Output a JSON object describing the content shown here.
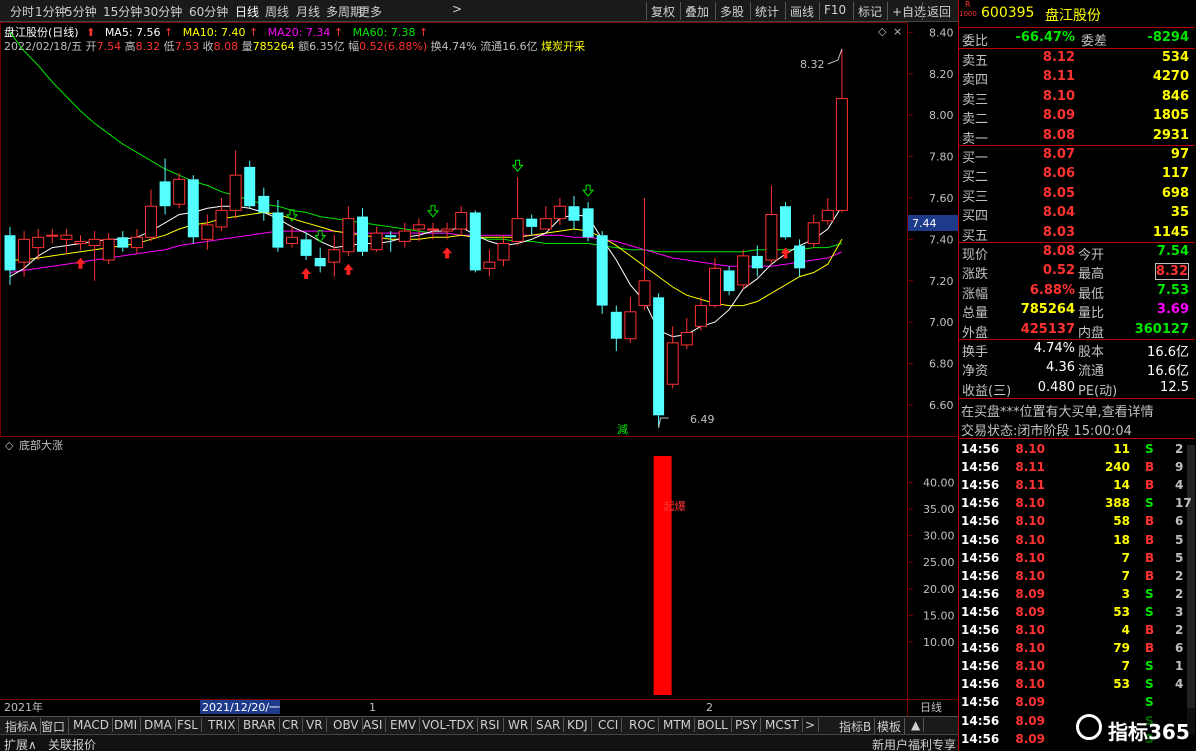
{
  "toolbar": {
    "periods": [
      "分时",
      "1分钟",
      "5分钟",
      "15分钟",
      "30分钟",
      "60分钟",
      "日线",
      "周线",
      "月线",
      "多周期",
      "更多"
    ],
    "active": "日线",
    "right_buttons": [
      "复权",
      "叠加",
      "多股",
      "统计",
      "画线",
      "F10",
      "标记",
      "+自选",
      "返回"
    ]
  },
  "chart_header": {
    "title": "盘江股份(日线)",
    "ma5": "MA5: 7.56",
    "ma10": "MA10: 7.40",
    "ma20": "MA20: 7.34",
    "ma60": "MA60: 7.38",
    "date": "2022/02/18/五",
    "open_label": "开",
    "open": "7.54",
    "high_label": "高",
    "high": "8.32",
    "low_label": "低",
    "low": "7.53",
    "close_label": "收",
    "close": "8.08",
    "vol_label": "量",
    "vol": "785264",
    "amount": "额6.35亿",
    "change_label": "幅",
    "change": "0.52(6.88%)",
    "turnover": "换4.74%",
    "float": "流通16.6亿",
    "concept": "煤炭开采"
  },
  "price_axis": [
    "8.40",
    "8.20",
    "8.00",
    "7.80",
    "7.60",
    "7.40",
    "7.20",
    "7.00",
    "6.80",
    "6.60"
  ],
  "price_tag": "7.44",
  "annotations": {
    "max_label": "8.32",
    "min_label": "6.49",
    "reduce_marker": "減"
  },
  "indicator": {
    "title": "底部大涨",
    "axis": [
      "40.00",
      "35.00",
      "30.00",
      "25.00",
      "20.00",
      "15.00",
      "10.00"
    ],
    "bar_label": "起爆"
  },
  "time_axis": {
    "year": "2021年",
    "cursor_date": "2021/12/20/一",
    "m1": "1",
    "m2": "2",
    "period": "日线"
  },
  "chart_data": {
    "type": "candlestick",
    "ylim": [
      6.45,
      8.45
    ],
    "candles": [
      [
        7.42,
        7.25,
        7.46,
        7.18
      ],
      [
        7.29,
        7.4,
        7.44,
        7.22
      ],
      [
        7.36,
        7.41,
        7.45,
        7.3
      ],
      [
        7.42,
        7.42,
        7.45,
        7.38
      ],
      [
        7.4,
        7.42,
        7.45,
        7.33
      ],
      [
        7.38,
        7.39,
        7.42,
        7.35
      ],
      [
        7.37,
        7.4,
        7.44,
        7.2
      ],
      [
        7.3,
        7.4,
        7.43,
        7.28
      ],
      [
        7.41,
        7.36,
        7.44,
        7.34
      ],
      [
        7.36,
        7.41,
        7.45,
        7.33
      ],
      [
        7.41,
        7.56,
        7.64,
        7.39
      ],
      [
        7.68,
        7.56,
        7.79,
        7.52
      ],
      [
        7.57,
        7.69,
        7.72,
        7.55
      ],
      [
        7.69,
        7.41,
        7.71,
        7.38
      ],
      [
        7.4,
        7.47,
        7.52,
        7.35
      ],
      [
        7.46,
        7.54,
        7.6,
        7.44
      ],
      [
        7.54,
        7.71,
        7.83,
        7.5
      ],
      [
        7.75,
        7.56,
        7.78,
        7.55
      ],
      [
        7.61,
        7.53,
        7.65,
        7.49
      ],
      [
        7.53,
        7.36,
        7.59,
        7.34
      ],
      [
        7.38,
        7.41,
        7.46,
        7.36
      ],
      [
        7.4,
        7.32,
        7.43,
        7.3
      ],
      [
        7.31,
        7.27,
        7.36,
        7.24
      ],
      [
        7.29,
        7.35,
        7.42,
        7.22
      ],
      [
        7.34,
        7.5,
        7.56,
        7.32
      ],
      [
        7.51,
        7.34,
        7.55,
        7.32
      ],
      [
        7.35,
        7.43,
        7.46,
        7.34
      ],
      [
        7.42,
        7.41,
        7.44,
        7.34
      ],
      [
        7.39,
        7.44,
        7.48,
        7.36
      ],
      [
        7.45,
        7.47,
        7.5,
        7.39
      ],
      [
        7.45,
        7.45,
        7.48,
        7.4
      ],
      [
        7.44,
        7.45,
        7.48,
        7.4
      ],
      [
        7.45,
        7.53,
        7.56,
        7.42
      ],
      [
        7.53,
        7.25,
        7.54,
        7.24
      ],
      [
        7.26,
        7.29,
        7.35,
        7.22
      ],
      [
        7.3,
        7.38,
        7.42,
        7.27
      ],
      [
        7.39,
        7.5,
        7.7,
        7.37
      ],
      [
        7.5,
        7.46,
        7.52,
        7.42
      ],
      [
        7.45,
        7.5,
        7.56,
        7.45
      ],
      [
        7.5,
        7.56,
        7.6,
        7.47
      ],
      [
        7.56,
        7.49,
        7.61,
        7.45
      ],
      [
        7.55,
        7.41,
        7.58,
        7.39
      ],
      [
        7.42,
        7.08,
        7.44,
        7.04
      ],
      [
        7.05,
        6.92,
        7.08,
        6.86
      ],
      [
        6.92,
        7.05,
        7.12,
        6.9
      ],
      [
        7.08,
        7.2,
        7.6,
        7.06
      ],
      [
        7.12,
        6.55,
        7.14,
        6.49
      ],
      [
        6.7,
        6.9,
        6.98,
        6.68
      ],
      [
        6.89,
        6.95,
        7.02,
        6.87
      ],
      [
        6.98,
        7.08,
        7.12,
        6.96
      ],
      [
        7.08,
        7.26,
        7.31,
        7.07
      ],
      [
        7.25,
        7.15,
        7.27,
        7.13
      ],
      [
        7.18,
        7.32,
        7.35,
        7.16
      ],
      [
        7.32,
        7.26,
        7.37,
        7.22
      ],
      [
        7.3,
        7.52,
        7.66,
        7.28
      ],
      [
        7.56,
        7.41,
        7.58,
        7.4
      ],
      [
        7.37,
        7.26,
        7.4,
        7.22
      ],
      [
        7.38,
        7.48,
        7.52,
        7.36
      ],
      [
        7.49,
        7.54,
        7.6,
        7.47
      ],
      [
        7.54,
        8.08,
        8.32,
        7.53
      ]
    ],
    "ma5": [
      7.22,
      7.26,
      7.32,
      7.36,
      7.37,
      7.38,
      7.39,
      7.4,
      7.4,
      7.41,
      7.44,
      7.48,
      7.52,
      7.53,
      7.55,
      7.56,
      7.56,
      7.55,
      7.53,
      7.5,
      7.46,
      7.43,
      7.39,
      7.36,
      7.37,
      7.38,
      7.38,
      7.39,
      7.41,
      7.42,
      7.44,
      7.44,
      7.46,
      7.42,
      7.39,
      7.37,
      7.38,
      7.4,
      7.43,
      7.5,
      7.52,
      7.51,
      7.4,
      7.3,
      7.18,
      7.1,
      6.96,
      6.93,
      6.94,
      6.98,
      7.0,
      7.06,
      7.16,
      7.21,
      7.28,
      7.33,
      7.37,
      7.4,
      7.45,
      7.56
    ],
    "ma10": [
      7.3,
      7.3,
      7.31,
      7.32,
      7.33,
      7.34,
      7.35,
      7.36,
      7.37,
      7.38,
      7.4,
      7.42,
      7.45,
      7.47,
      7.48,
      7.5,
      7.51,
      7.52,
      7.53,
      7.52,
      7.5,
      7.48,
      7.46,
      7.44,
      7.43,
      7.42,
      7.41,
      7.4,
      7.4,
      7.4,
      7.41,
      7.41,
      7.42,
      7.41,
      7.41,
      7.41,
      7.41,
      7.42,
      7.43,
      7.44,
      7.45,
      7.44,
      7.41,
      7.37,
      7.32,
      7.27,
      7.22,
      7.17,
      7.13,
      7.11,
      7.09,
      7.08,
      7.08,
      7.1,
      7.14,
      7.18,
      7.22,
      7.24,
      7.28,
      7.4
    ],
    "ma20": [
      7.24,
      7.25,
      7.26,
      7.27,
      7.28,
      7.29,
      7.3,
      7.31,
      7.32,
      7.33,
      7.34,
      7.35,
      7.37,
      7.38,
      7.39,
      7.4,
      7.41,
      7.42,
      7.43,
      7.44,
      7.44,
      7.44,
      7.44,
      7.44,
      7.43,
      7.43,
      7.43,
      7.43,
      7.43,
      7.43,
      7.43,
      7.43,
      7.42,
      7.42,
      7.42,
      7.42,
      7.42,
      7.42,
      7.42,
      7.42,
      7.41,
      7.41,
      7.4,
      7.39,
      7.37,
      7.35,
      7.33,
      7.31,
      7.3,
      7.29,
      7.28,
      7.27,
      7.27,
      7.27,
      7.27,
      7.28,
      7.29,
      7.3,
      7.31,
      7.34
    ],
    "ma60": [
      8.4,
      8.31,
      8.24,
      8.16,
      8.09,
      8.02,
      7.96,
      7.91,
      7.86,
      7.82,
      7.78,
      7.74,
      7.71,
      7.68,
      7.66,
      7.63,
      7.61,
      7.59,
      7.57,
      7.56,
      7.54,
      7.53,
      7.51,
      7.5,
      7.49,
      7.48,
      7.47,
      7.46,
      7.45,
      7.44,
      7.43,
      7.43,
      7.42,
      7.41,
      7.4,
      7.4,
      7.39,
      7.39,
      7.38,
      7.38,
      7.38,
      7.38,
      7.37,
      7.36,
      7.35,
      7.35,
      7.34,
      7.34,
      7.34,
      7.34,
      7.34,
      7.34,
      7.34,
      7.35,
      7.35,
      7.35,
      7.35,
      7.36,
      7.36,
      7.38
    ],
    "up_arrows": [
      5,
      21,
      24,
      31,
      55
    ],
    "down_arrows": [
      20,
      22,
      30,
      36,
      41
    ],
    "indicator_ylim": [
      0,
      45
    ],
    "indicator_bars": [
      {
        "index": 46,
        "value": 45
      }
    ]
  },
  "quote": {
    "ticker": "600395",
    "name": "盘江股份",
    "corner_r": "R",
    "corner_n": "1000",
    "webi_label": "委比",
    "webi": "-66.47%",
    "weicha_label": "委差",
    "weicha": "-8294",
    "asks": [
      {
        "label": "卖五",
        "price": "8.12",
        "vol": "534"
      },
      {
        "label": "卖四",
        "price": "8.11",
        "vol": "4270"
      },
      {
        "label": "卖三",
        "price": "8.10",
        "vol": "846"
      },
      {
        "label": "卖二",
        "price": "8.09",
        "vol": "1805"
      },
      {
        "label": "卖一",
        "price": "8.08",
        "vol": "2931"
      }
    ],
    "bids": [
      {
        "label": "买一",
        "price": "8.07",
        "vol": "97"
      },
      {
        "label": "买二",
        "price": "8.06",
        "vol": "117"
      },
      {
        "label": "买三",
        "price": "8.05",
        "vol": "698"
      },
      {
        "label": "买四",
        "price": "8.04",
        "vol": "35"
      },
      {
        "label": "买五",
        "price": "8.03",
        "vol": "1145"
      }
    ],
    "stats": [
      {
        "l1": "现价",
        "v1": "8.08",
        "l2": "今开",
        "v2": "7.54"
      },
      {
        "l1": "涨跌",
        "v1": "0.52",
        "l2": "最高",
        "v2": "8.32"
      },
      {
        "l1": "涨幅",
        "v1": "6.88%",
        "l2": "最低",
        "v2": "7.53"
      },
      {
        "l1": "总量",
        "v1": "785264",
        "l2": "量比",
        "v2": "3.69"
      },
      {
        "l1": "外盘",
        "v1": "425137",
        "l2": "内盘",
        "v2": "360127"
      }
    ],
    "fundamentals": [
      {
        "l1": "换手",
        "v1": "4.74%",
        "l2": "股本",
        "v2": "16.6亿"
      },
      {
        "l1": "净资",
        "v1": "4.36",
        "l2": "流通",
        "v2": "16.6亿"
      },
      {
        "l1": "收益(三)",
        "v1": "0.480",
        "l2": "PE(动)",
        "v2": "12.5"
      }
    ],
    "notice": "在买盘***位置有大买单,查看详情",
    "state": "交易状态:闭市阶段 15:00:04",
    "ticks": [
      {
        "t": "14:56",
        "p": "8.10",
        "v": "11",
        "d": "S",
        "n": "2"
      },
      {
        "t": "14:56",
        "p": "8.11",
        "v": "240",
        "d": "B",
        "n": "9"
      },
      {
        "t": "14:56",
        "p": "8.11",
        "v": "14",
        "d": "B",
        "n": "4"
      },
      {
        "t": "14:56",
        "p": "8.10",
        "v": "388",
        "d": "S",
        "n": "17"
      },
      {
        "t": "14:56",
        "p": "8.10",
        "v": "58",
        "d": "B",
        "n": "6"
      },
      {
        "t": "14:56",
        "p": "8.10",
        "v": "18",
        "d": "B",
        "n": "5"
      },
      {
        "t": "14:56",
        "p": "8.10",
        "v": "7",
        "d": "B",
        "n": "5"
      },
      {
        "t": "14:56",
        "p": "8.10",
        "v": "7",
        "d": "B",
        "n": "2"
      },
      {
        "t": "14:56",
        "p": "8.09",
        "v": "3",
        "d": "S",
        "n": "2"
      },
      {
        "t": "14:56",
        "p": "8.09",
        "v": "53",
        "d": "S",
        "n": "3"
      },
      {
        "t": "14:56",
        "p": "8.10",
        "v": "4",
        "d": "B",
        "n": "2"
      },
      {
        "t": "14:56",
        "p": "8.10",
        "v": "79",
        "d": "B",
        "n": "6"
      },
      {
        "t": "14:56",
        "p": "8.10",
        "v": "7",
        "d": "S",
        "n": "1"
      },
      {
        "t": "14:56",
        "p": "8.10",
        "v": "53",
        "d": "S",
        "n": "4"
      },
      {
        "t": "14:56",
        "p": "8.09",
        "v": "",
        "d": "S",
        "n": ""
      },
      {
        "t": "14:56",
        "p": "8.09",
        "v": "",
        "d": "S",
        "n": ""
      },
      {
        "t": "14:56",
        "p": "8.09",
        "v": "",
        "d": "S",
        "n": ""
      }
    ]
  },
  "tabs": [
    "指标A",
    "窗口",
    "MACD",
    "DMI",
    "DMA",
    "FSL",
    "TRIX",
    "BRAR",
    "CR",
    "VR",
    "OBV",
    "ASI",
    "EMV",
    "VOL-TDX",
    "RSI",
    "WR",
    "SAR",
    "KDJ",
    "CCI",
    "ROC",
    "MTM",
    "BOLL",
    "PSY",
    "MCST",
    ">",
    "指标B",
    "模板",
    "▲"
  ],
  "status": {
    "left1": "扩展∧",
    "left2": "关联报价",
    "promo": "新用户福利专享",
    "watermark": "指标365"
  },
  "colors": {
    "up": "#ff3232",
    "down": "#54ffff",
    "ma5": "#ffffff",
    "ma10": "#ffff00",
    "ma20": "#ff00ff",
    "ma60": "#00e600"
  }
}
